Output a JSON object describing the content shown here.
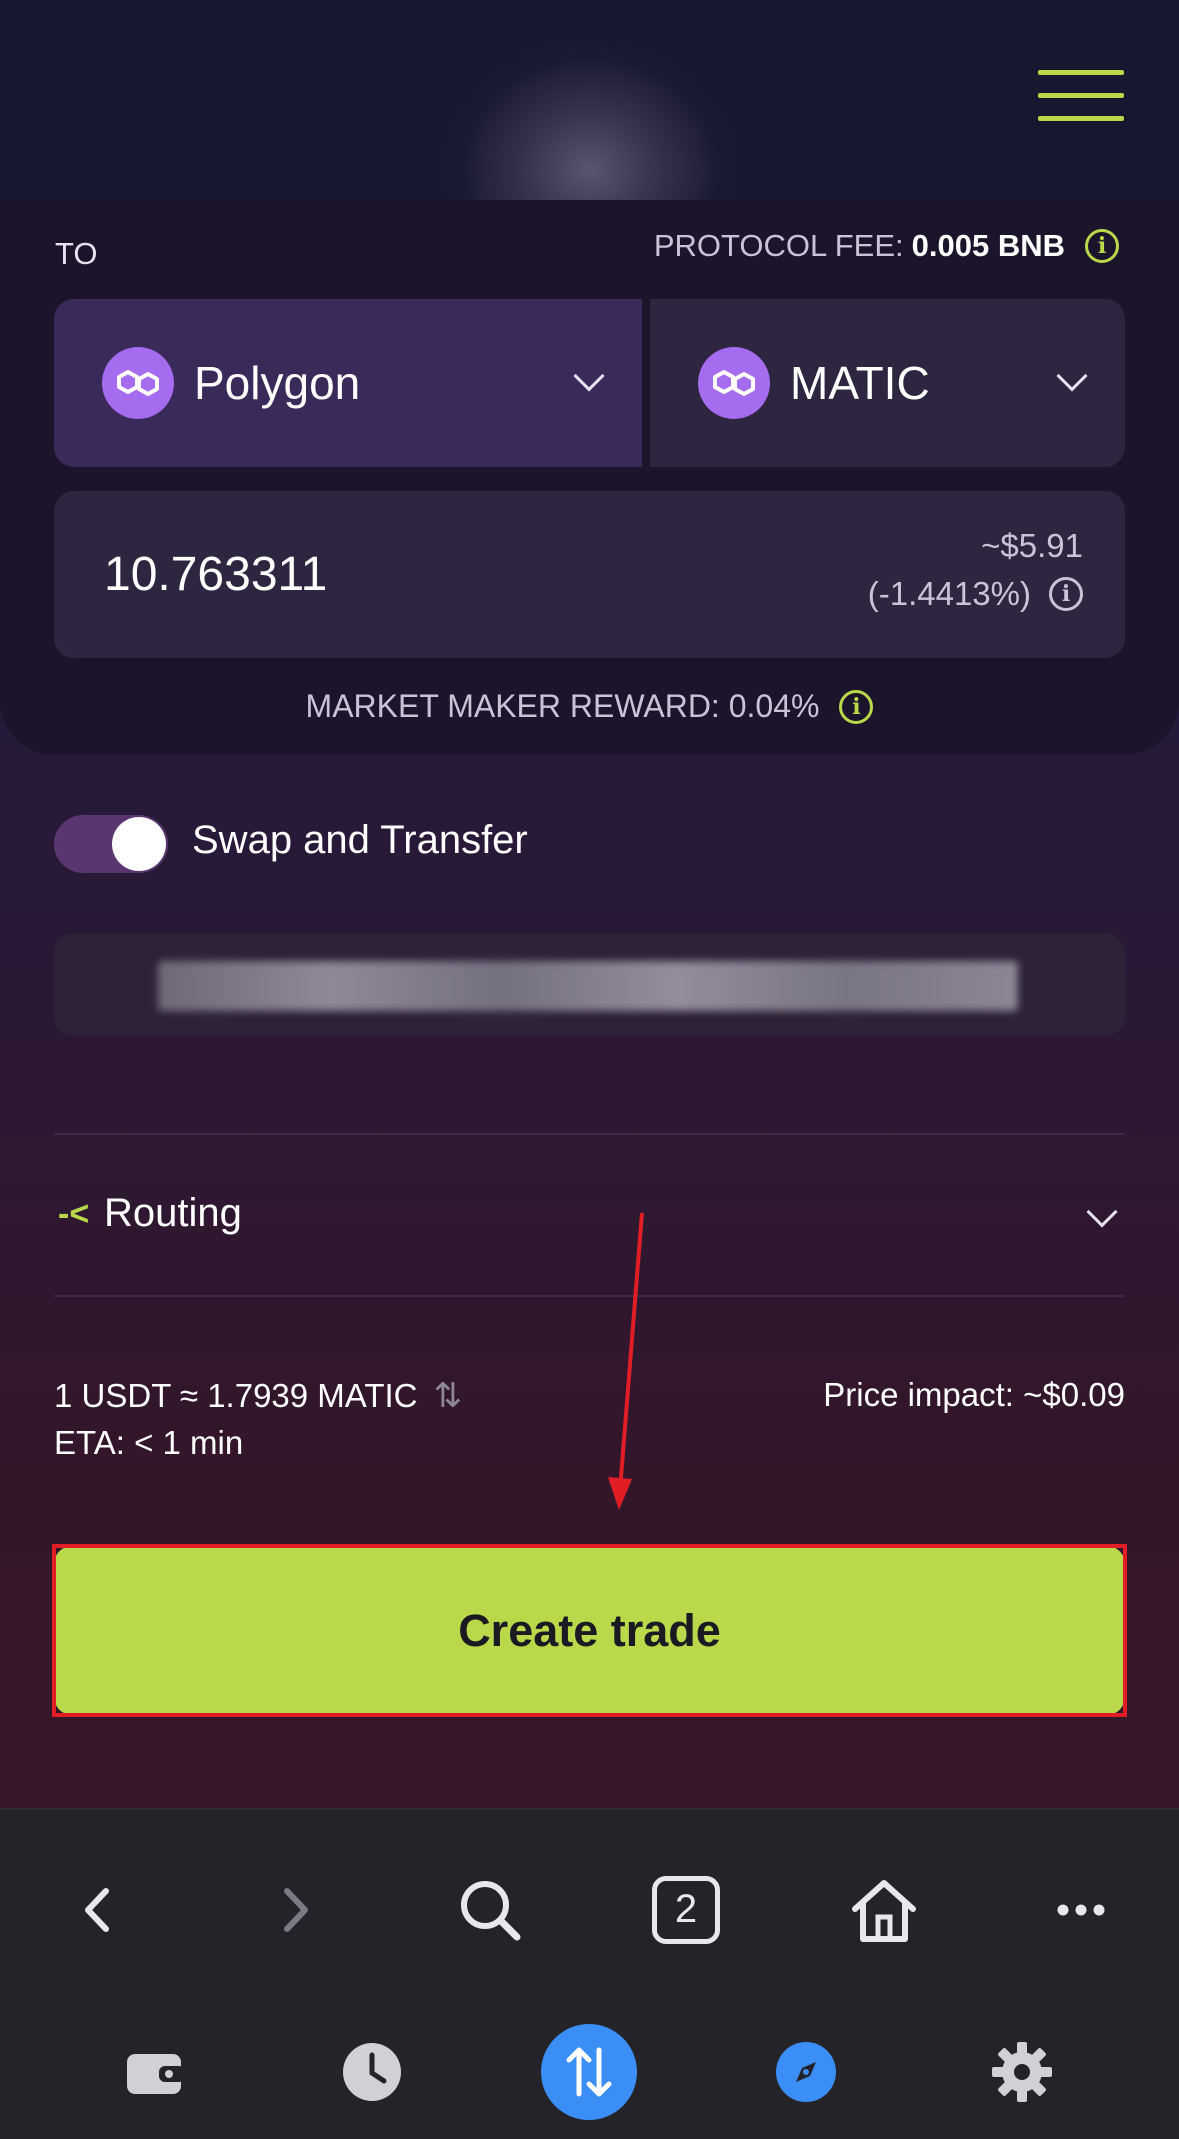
{
  "to_section": {
    "label": "TO",
    "fee_label": "PROTOCOL FEE:",
    "fee_value": "0.005 BNB",
    "network": "Polygon",
    "token": "MATIC",
    "amount": "10.763311",
    "usd_value": "~$5.91",
    "usd_change": "(-1.4413%)",
    "reward": "MARKET MAKER REWARD: 0.04%"
  },
  "swap_transfer": {
    "label": "Swap and Transfer",
    "enabled": true
  },
  "routing": {
    "icon": "route-icon",
    "label": "Routing"
  },
  "summary": {
    "rate": "1 USDT ≈ 1.7939 MATIC",
    "eta": "ETA: < 1 min",
    "price_impact": "Price impact: ~$0.09"
  },
  "create_button": {
    "label": "Create trade"
  },
  "browser_toolbar": {
    "tab_count": "2",
    "icons": [
      "back-icon",
      "forward-icon",
      "search-icon",
      "tabs-icon",
      "home-icon",
      "more-icon"
    ]
  },
  "app_nav": {
    "icons": [
      "wallet-icon",
      "history-icon",
      "swap-icon",
      "explore-icon",
      "settings-icon"
    ]
  },
  "colors": {
    "accent": "#b9d94b",
    "polygon": "#a56cf0",
    "nav_active": "#3b8ef5",
    "highlight": "#e11d26"
  }
}
